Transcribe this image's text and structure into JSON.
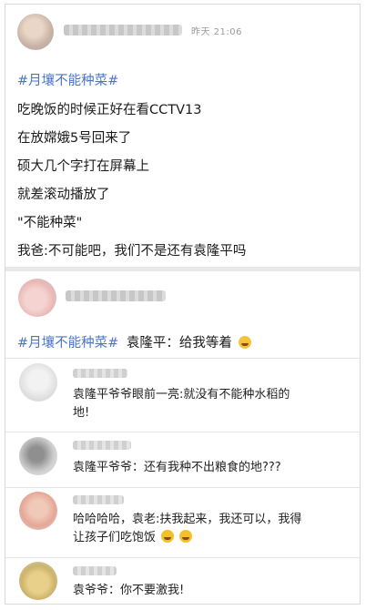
{
  "post": {
    "time": "昨天 21:06",
    "topic": "#月壤不能种菜#",
    "lines": [
      "吃晚饭的时候正好在看CCTV13",
      "在放嫦娥5号回来了",
      "硕大几个字打在屏幕上",
      "就差滚动播放了",
      "\"不能种菜\"",
      "我爸:不可能吧，我们不是还有袁隆平吗"
    ]
  },
  "reply": {
    "topic": "#月壤不能种菜#",
    "text": "袁隆平：给我等着"
  },
  "comments": [
    {
      "text_1": "袁隆平爷爷眼前一亮:就没有不能种水稻的",
      "text_2": "地!"
    },
    {
      "text_1": "袁隆平爷爷：还有我种不出粮食的地???"
    },
    {
      "text_1": "哈哈哈哈，袁老:扶我起来，我还可以，我得",
      "text_2": "让孩子们吃饱饭"
    },
    {
      "text_1": "袁爷爷：你不要激我!"
    }
  ],
  "icons": [
    "grin-emoji",
    "grin-emoji",
    "sunglasses-emoji"
  ],
  "colors": {
    "topic": "#4a74c8",
    "text": "#1a1a1a",
    "divider": "#e4e4e4"
  }
}
